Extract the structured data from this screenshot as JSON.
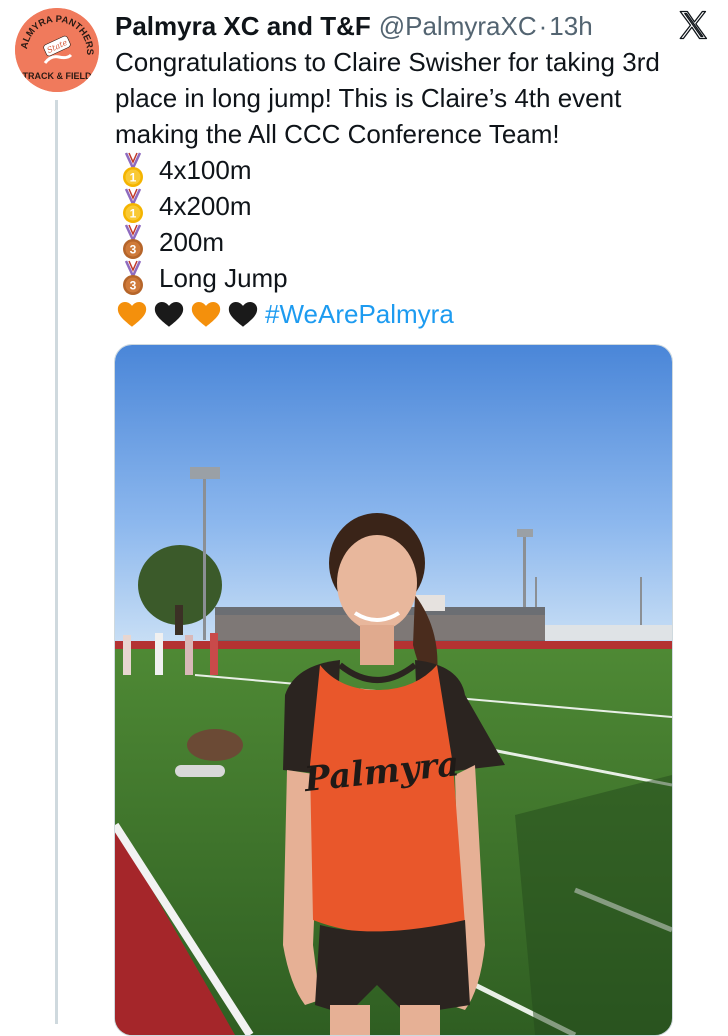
{
  "tweet": {
    "author": {
      "display_name": "Palmyra XC and T&F",
      "handle": "@PalmyraXC",
      "separator": "·",
      "timestamp": "13h",
      "avatar_icon": "palmyra-panthers-logo",
      "avatar_text_top": "PALMYRA PANTHERS",
      "avatar_text_script": "State",
      "avatar_text_bottom": "TRACK & FIELD",
      "avatar_color": "#f07a5c"
    },
    "platform_icon": "x-logo-icon",
    "text_lines": [
      "Congratulations to Claire Swisher for taking 3rd",
      "place in long jump! This is Claire’s 4th event",
      "making the All CCC Conference Team!"
    ],
    "events": [
      {
        "medal": "gold-medal-icon",
        "medal_number": "1",
        "label": "4x100m"
      },
      {
        "medal": "gold-medal-icon",
        "medal_number": "1",
        "label": "4x200m"
      },
      {
        "medal": "bronze-medal-icon",
        "medal_number": "3",
        "label": "200m"
      },
      {
        "medal": "bronze-medal-icon",
        "medal_number": "3",
        "label": "Long Jump"
      }
    ],
    "hearts": [
      "orange-heart-icon",
      "black-heart-icon",
      "orange-heart-icon",
      "black-heart-icon"
    ],
    "hashtag": "#WeArePalmyra",
    "colors": {
      "link": "#1d9bf0",
      "secondary_text": "#536471",
      "primary_text": "#0f1419",
      "thread_line": "#cfd9de"
    },
    "media": {
      "type": "photo",
      "jersey_text": "Palmyra"
    }
  }
}
